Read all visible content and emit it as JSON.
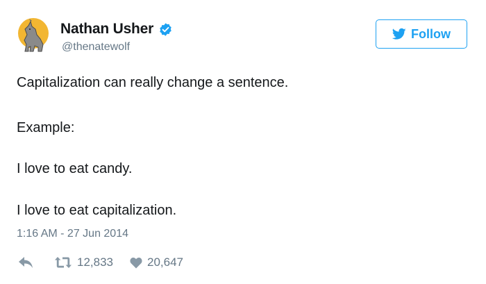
{
  "user": {
    "display_name": "Nathan Usher",
    "handle": "@thenatewolf",
    "verified": true
  },
  "follow_button": {
    "label": "Follow"
  },
  "tweet": {
    "lines": [
      "Capitalization can really change a sentence.",
      "Example:",
      "I love to eat candy.",
      "I love to eat capitalization."
    ],
    "timestamp": "1:16 AM - 27 Jun 2014"
  },
  "actions": {
    "retweet_count": "12,833",
    "like_count": "20,647"
  },
  "colors": {
    "accent": "#1da1f2",
    "text": "#14171a",
    "muted": "#657786",
    "icon": "#8899a6",
    "avatar_moon": "#f2b632"
  },
  "icons": {
    "avatar": "howling-wolf-avatar",
    "verified": "verified-badge-icon",
    "follow": "bird-icon",
    "reply": "reply-icon",
    "retweet": "retweet-icon",
    "like": "heart-icon"
  }
}
